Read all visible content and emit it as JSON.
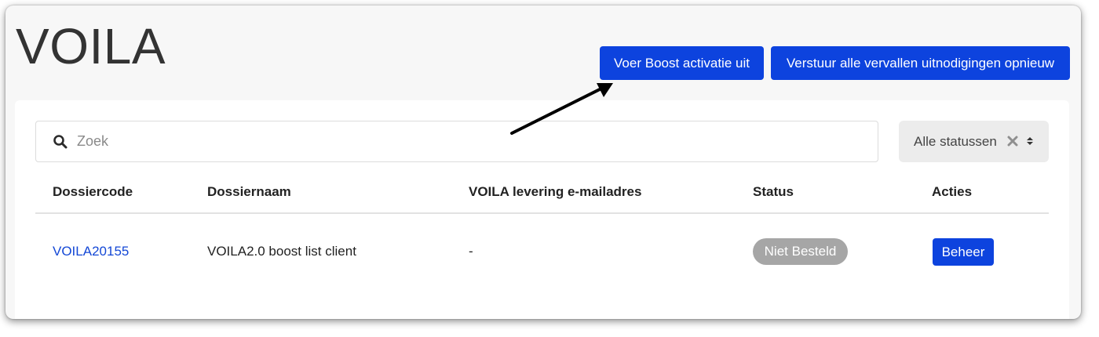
{
  "header": {
    "title": "VOILA",
    "boost_button": "Voer Boost activatie uit",
    "resend_button": "Verstuur alle vervallen uitnodigingen opnieuw"
  },
  "search": {
    "placeholder": "Zoek",
    "value": ""
  },
  "status_filter": {
    "selected": "Alle statussen"
  },
  "table": {
    "columns": [
      "Dossiercode",
      "Dossiernaam",
      "VOILA levering e-mailadres",
      "Status",
      "Acties"
    ],
    "rows": [
      {
        "code": "VOILA20155",
        "name": "VOILA2.0 boost list client",
        "email": "-",
        "status": "Niet Besteld",
        "action": "Beheer"
      }
    ]
  },
  "colors": {
    "primary": "#0d43de",
    "link": "#1448d6",
    "badge_grey": "#a6a6a6"
  },
  "icons": [
    "search-icon",
    "clear-icon",
    "sort-icon",
    "arrow-annotation-icon"
  ]
}
